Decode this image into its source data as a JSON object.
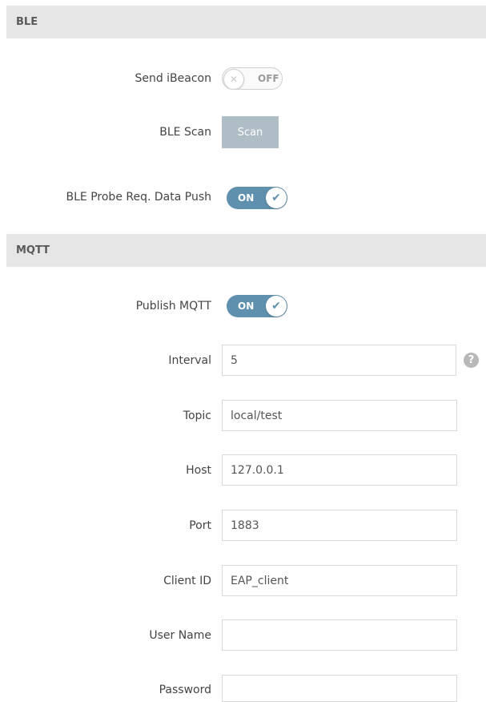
{
  "ble": {
    "section_title": "BLE",
    "send_ibeacon": {
      "label": "Send iBeacon",
      "state": "OFF"
    },
    "ble_scan": {
      "label": "BLE Scan",
      "button_label": "Scan"
    },
    "probe_push": {
      "label": "BLE Probe Req. Data Push",
      "state": "ON"
    }
  },
  "mqtt": {
    "section_title": "MQTT",
    "publish": {
      "label": "Publish MQTT",
      "state": "ON"
    },
    "interval": {
      "label": "Interval",
      "value": "5",
      "help_icon": "?"
    },
    "topic": {
      "label": "Topic",
      "value": "local/test"
    },
    "host": {
      "label": "Host",
      "value": "127.0.0.1"
    },
    "port": {
      "label": "Port",
      "value": "1883"
    },
    "client_id": {
      "label": "Client ID",
      "value": "EAP_client"
    },
    "user_name": {
      "label": "User Name",
      "value": ""
    },
    "password": {
      "label": "Password",
      "value": ""
    }
  },
  "icons": {
    "off_knob": "close-icon",
    "on_knob": "check-icon",
    "help": "help-icon"
  },
  "colors": {
    "toggle_on": "#5f90ad",
    "scan_button": "#aebdc6",
    "section_header": "#e6e6e6"
  }
}
